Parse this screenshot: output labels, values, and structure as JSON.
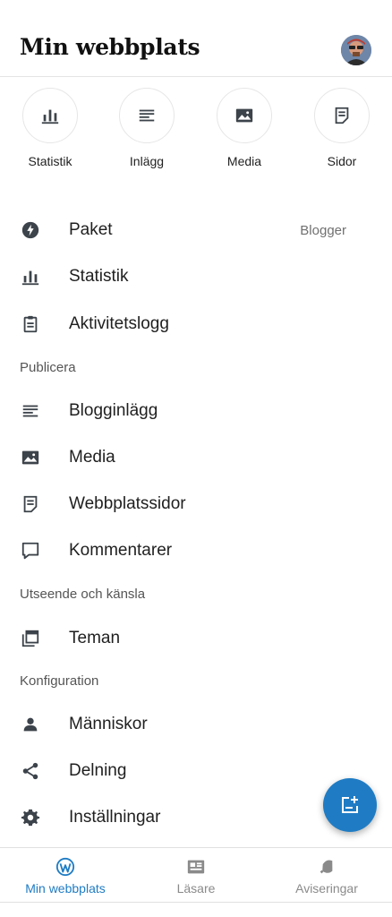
{
  "header": {
    "title": "Min webbplats"
  },
  "quick_actions": [
    {
      "label": "Statistik",
      "icon": "stats-icon"
    },
    {
      "label": "Inlägg",
      "icon": "posts-icon"
    },
    {
      "label": "Media",
      "icon": "media-icon"
    },
    {
      "label": "Sidor",
      "icon": "pages-icon"
    }
  ],
  "menu": {
    "paket": {
      "label": "Paket",
      "meta": "Blogger"
    },
    "statistik": {
      "label": "Statistik"
    },
    "aktivitetslogg": {
      "label": "Aktivitetslogg"
    },
    "section_publicera": "Publicera",
    "blogginlagg": {
      "label": "Blogginlägg"
    },
    "media": {
      "label": "Media"
    },
    "webbplatssidor": {
      "label": "Webbplatssidor"
    },
    "kommentarer": {
      "label": "Kommentarer"
    },
    "section_utseende": "Utseende och känsla",
    "teman": {
      "label": "Teman"
    },
    "section_konfiguration": "Konfiguration",
    "manniskor": {
      "label": "Människor"
    },
    "delning": {
      "label": "Delning"
    },
    "installningar": {
      "label": "Inställningar"
    }
  },
  "bottom_nav": [
    {
      "label": "Min webbplats",
      "icon": "wordpress-icon",
      "active": true
    },
    {
      "label": "Läsare",
      "icon": "reader-icon",
      "active": false
    },
    {
      "label": "Aviseringar",
      "icon": "bell-icon",
      "active": false
    }
  ],
  "colors": {
    "accent": "#1f7cc4",
    "icon": "#3c434a",
    "text": "#1f1f1f"
  }
}
